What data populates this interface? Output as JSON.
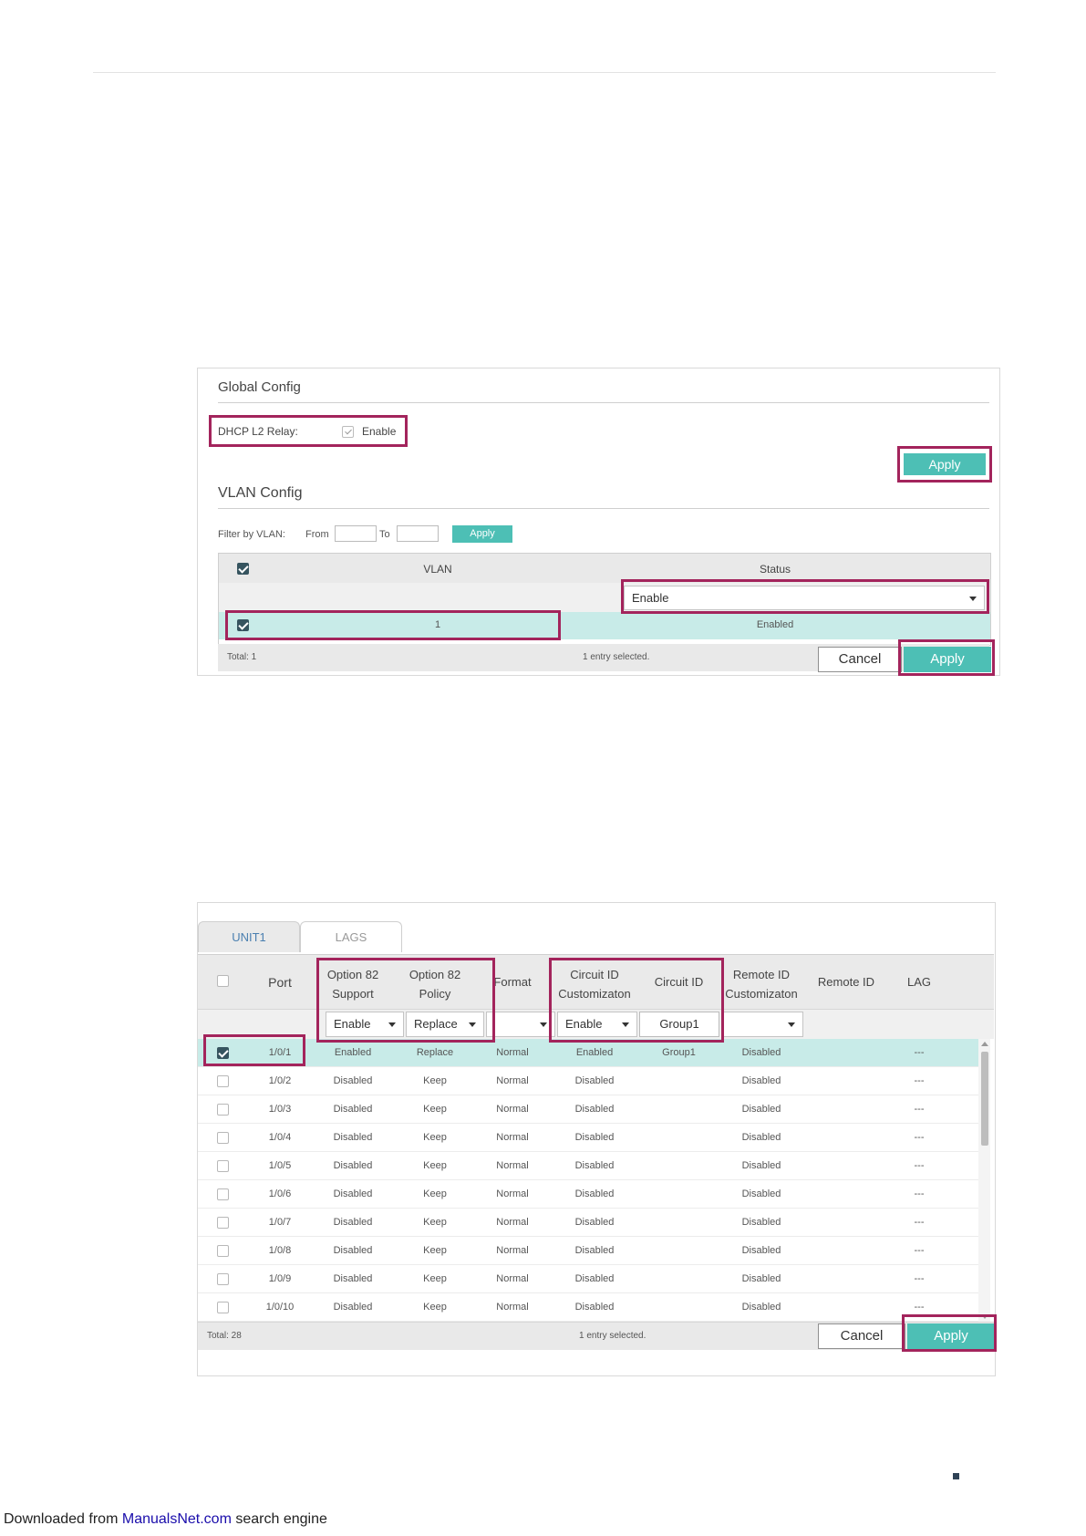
{
  "global_config": {
    "title": "Global Config",
    "relay_label": "DHCP L2 Relay:",
    "relay_enable": "Enable",
    "apply": "Apply"
  },
  "vlan_config": {
    "title": "VLAN Config",
    "filter_label": "Filter by VLAN:",
    "from_label": "From",
    "to_label": "To",
    "filter_apply": "Apply",
    "col_vlan": "VLAN",
    "col_status": "Status",
    "status_select": "Enable",
    "row": {
      "vlan": "1",
      "status": "Enabled"
    },
    "total": "Total: 1",
    "selected": "1 entry selected.",
    "cancel": "Cancel",
    "apply": "Apply"
  },
  "port_config": {
    "tabs": [
      "UNIT1",
      "LAGS"
    ],
    "headers": {
      "port": "Port",
      "opt82_support_1": "Option 82",
      "opt82_support_2": "Support",
      "opt82_policy_1": "Option 82",
      "opt82_policy_2": "Policy",
      "format": "Format",
      "circuit_cust_1": "Circuit ID",
      "circuit_cust_2": "Customizaton",
      "circuit_id": "Circuit ID",
      "remote_cust_1": "Remote ID",
      "remote_cust_2": "Customizaton",
      "remote_id": "Remote ID",
      "lag": "LAG"
    },
    "edit_row": {
      "support": "Enable",
      "policy": "Replace",
      "format": "",
      "circuit_cust": "Enable",
      "circuit_id": "Group1",
      "remote_cust": ""
    },
    "rows": [
      {
        "port": "1/0/1",
        "support": "Enabled",
        "policy": "Replace",
        "format": "Normal",
        "circuit_cust": "Enabled",
        "circuit_id": "Group1",
        "remote_cust": "Disabled",
        "remote_id": "",
        "lag": "---"
      },
      {
        "port": "1/0/2",
        "support": "Disabled",
        "policy": "Keep",
        "format": "Normal",
        "circuit_cust": "Disabled",
        "circuit_id": "",
        "remote_cust": "Disabled",
        "remote_id": "",
        "lag": "---"
      },
      {
        "port": "1/0/3",
        "support": "Disabled",
        "policy": "Keep",
        "format": "Normal",
        "circuit_cust": "Disabled",
        "circuit_id": "",
        "remote_cust": "Disabled",
        "remote_id": "",
        "lag": "---"
      },
      {
        "port": "1/0/4",
        "support": "Disabled",
        "policy": "Keep",
        "format": "Normal",
        "circuit_cust": "Disabled",
        "circuit_id": "",
        "remote_cust": "Disabled",
        "remote_id": "",
        "lag": "---"
      },
      {
        "port": "1/0/5",
        "support": "Disabled",
        "policy": "Keep",
        "format": "Normal",
        "circuit_cust": "Disabled",
        "circuit_id": "",
        "remote_cust": "Disabled",
        "remote_id": "",
        "lag": "---"
      },
      {
        "port": "1/0/6",
        "support": "Disabled",
        "policy": "Keep",
        "format": "Normal",
        "circuit_cust": "Disabled",
        "circuit_id": "",
        "remote_cust": "Disabled",
        "remote_id": "",
        "lag": "---"
      },
      {
        "port": "1/0/7",
        "support": "Disabled",
        "policy": "Keep",
        "format": "Normal",
        "circuit_cust": "Disabled",
        "circuit_id": "",
        "remote_cust": "Disabled",
        "remote_id": "",
        "lag": "---"
      },
      {
        "port": "1/0/8",
        "support": "Disabled",
        "policy": "Keep",
        "format": "Normal",
        "circuit_cust": "Disabled",
        "circuit_id": "",
        "remote_cust": "Disabled",
        "remote_id": "",
        "lag": "---"
      },
      {
        "port": "1/0/9",
        "support": "Disabled",
        "policy": "Keep",
        "format": "Normal",
        "circuit_cust": "Disabled",
        "circuit_id": "",
        "remote_cust": "Disabled",
        "remote_id": "",
        "lag": "---"
      },
      {
        "port": "1/0/10",
        "support": "Disabled",
        "policy": "Keep",
        "format": "Normal",
        "circuit_cust": "Disabled",
        "circuit_id": "",
        "remote_cust": "Disabled",
        "remote_id": "",
        "lag": "---"
      }
    ],
    "total": "Total: 28",
    "selected": "1 entry selected.",
    "cancel": "Cancel",
    "apply": "Apply"
  },
  "footer": {
    "prefix": "Downloaded from",
    "link": "ManualsNet.com",
    "suffix": "search engine"
  },
  "colors": {
    "highlight": "#a3245c",
    "accent": "#4dbfb5",
    "selected_row": "#c8ebe8",
    "link": "#1a0dab"
  }
}
